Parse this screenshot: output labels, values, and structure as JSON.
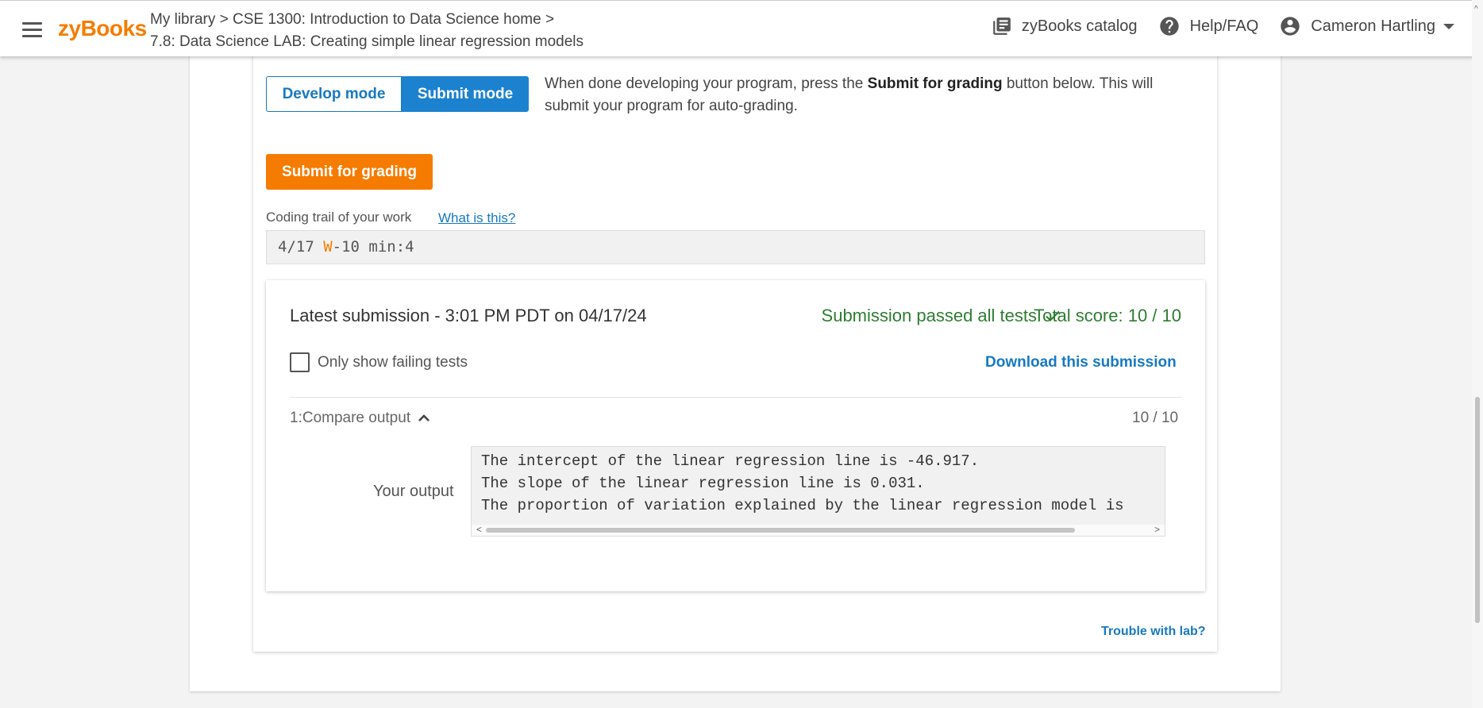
{
  "header": {
    "logo": "zyBooks",
    "breadcrumb_line1": "My library > CSE 1300: Introduction to Data Science home >",
    "breadcrumb_line2": "7.8: Data Science LAB: Creating simple linear regression models",
    "catalog_label": "zyBooks catalog",
    "help_label": "Help/FAQ",
    "user_name": "Cameron Hartling"
  },
  "modes": {
    "develop_label": "Develop mode",
    "submit_label": "Submit mode",
    "help_prefix": "When done developing your program, press the ",
    "help_bold": "Submit for grading",
    "help_suffix": " button below. This will submit your program for auto-grading."
  },
  "submit_button": "Submit for grading",
  "coding_trail": {
    "label": "Coding trail of your work",
    "link": "What is this?",
    "date": "4/17 ",
    "w": "W",
    "rest": "-10 min:4"
  },
  "submission": {
    "latest": "Latest submission - 3:01 PM PDT on 04/17/24",
    "passed": "Submission passed all tests",
    "total": "Total score: 10 / 10",
    "failing_only_label": "Only show failing tests",
    "download_label": "Download this submission",
    "test_name": "1:Compare output",
    "test_score": "10 / 10",
    "output_label": "Your output",
    "output_lines": [
      "The intercept of the linear regression line is -46.917.",
      "The slope of the linear regression line is 0.031.",
      "The proportion of variation explained by the linear regression model is"
    ]
  },
  "trouble_link": "Trouble with lab?",
  "colors": {
    "brand_orange": "#f57c00",
    "link_blue": "#1779c2",
    "success_green": "#2e7d32"
  },
  "icons": {
    "menu": "hamburger-icon",
    "catalog": "library-books-icon",
    "help": "help-circle-icon",
    "user": "account-circle-icon",
    "dropdown": "caret-down-icon",
    "check": "check-icon",
    "expand": "chevron-up-icon"
  }
}
